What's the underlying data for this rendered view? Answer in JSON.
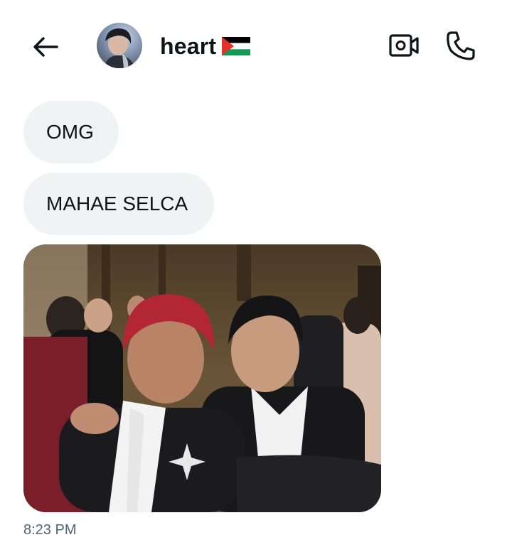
{
  "header": {
    "contact_name": "heart",
    "flag_icon": "palestine-flag-icon"
  },
  "messages": [
    {
      "type": "text",
      "text": "OMG"
    },
    {
      "type": "text",
      "text": "MAHAE SELCA"
    },
    {
      "type": "image",
      "icon": "photo"
    }
  ],
  "timestamp": "8:23 PM",
  "colors": {
    "bubble_bg": "#eff3f4",
    "text": "#0f1419",
    "meta_text": "#536471"
  }
}
